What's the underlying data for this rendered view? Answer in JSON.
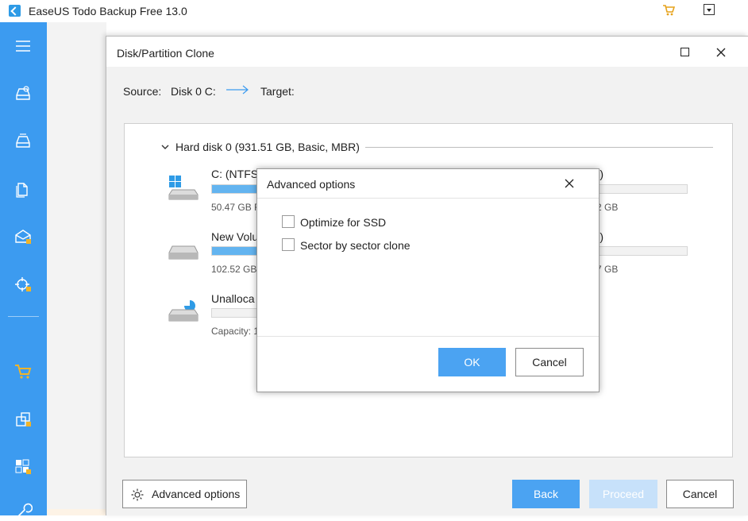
{
  "app": {
    "title": "EaseUS Todo Backup Free 13.0",
    "accent_color": "#3c9bf0",
    "icons": [
      "app-logo-icon",
      "cart-icon",
      "dropdown-menu-icon"
    ]
  },
  "sidebar": {
    "items": [
      {
        "icon": "hamburger-menu-icon"
      },
      {
        "icon": "disk-backup-icon"
      },
      {
        "icon": "system-backup-icon"
      },
      {
        "icon": "file-backup-icon"
      },
      {
        "icon": "mail-backup-icon"
      },
      {
        "icon": "smart-backup-icon"
      },
      {
        "icon": "cart-icon"
      },
      {
        "icon": "clone-icon"
      },
      {
        "icon": "tools-icon"
      },
      {
        "icon": "wrench-icon"
      }
    ]
  },
  "clone_window": {
    "title": "Disk/Partition Clone",
    "source_label": "Source:",
    "source_value": "Disk 0 C:",
    "target_label": "Target:",
    "disk_header": "Hard disk 0 (931.51 GB, Basic, MBR)",
    "partitions": [
      {
        "name": "C: (NTFS)",
        "info": "50.47 GB F",
        "fill": 0.28,
        "icon": "windows-drive-icon",
        "right_name": "S)",
        "right_info": "2 GB"
      },
      {
        "name": "New Volu",
        "info": "102.52 GB",
        "fill": 0.28,
        "icon": "drive-icon",
        "right_name": "S)",
        "right_info": "7 GB"
      },
      {
        "name": "Unalloca",
        "info": "Capacity: 1",
        "fill": 0.0,
        "icon": "unallocated-drive-icon"
      }
    ],
    "advanced_options_label": "Advanced options",
    "back_label": "Back",
    "proceed_label": "Proceed",
    "cancel_label": "Cancel"
  },
  "modal": {
    "title": "Advanced options",
    "options": [
      {
        "label": "Optimize for SSD",
        "checked": false
      },
      {
        "label": "Sector by sector clone",
        "checked": false
      }
    ],
    "ok_label": "OK",
    "cancel_label": "Cancel"
  }
}
